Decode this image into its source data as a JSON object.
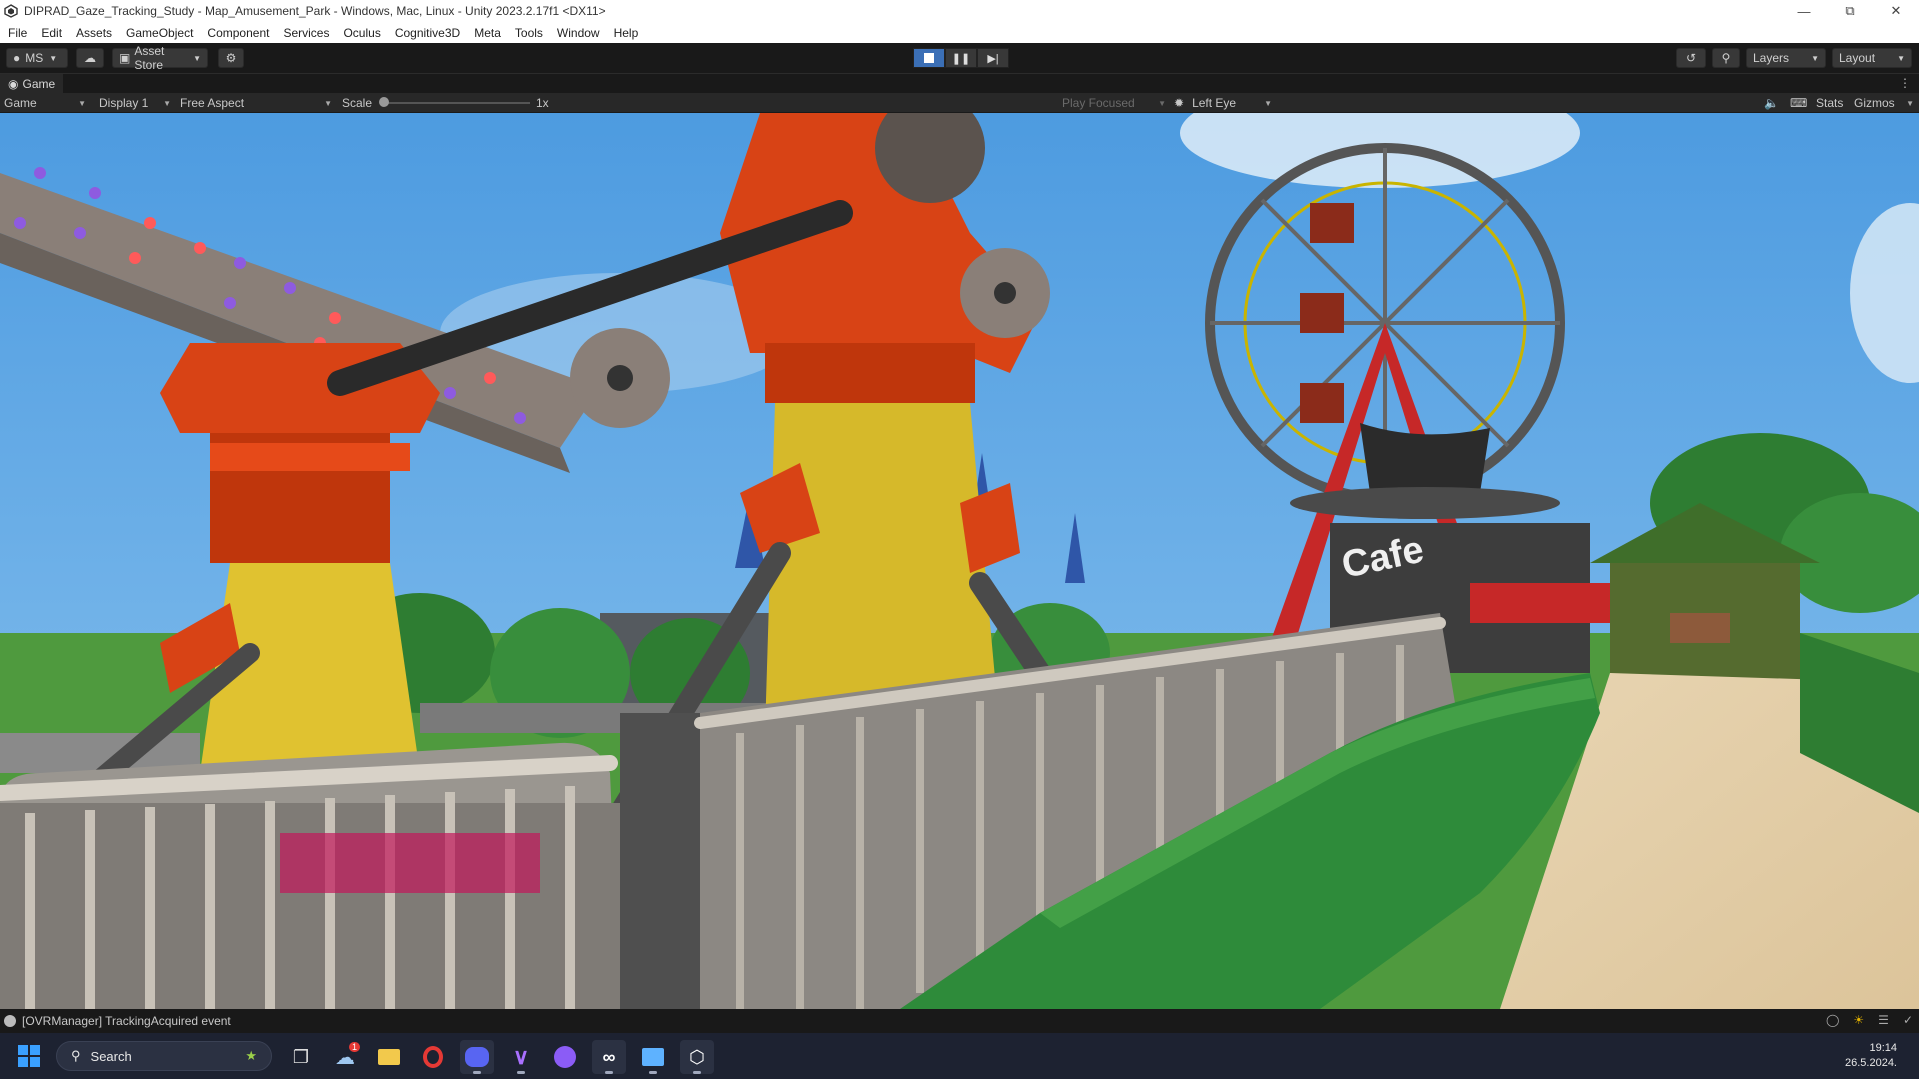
{
  "window": {
    "title": "DIPRAD_Gaze_Tracking_Study - Map_Amusement_Park - Windows, Mac, Linux - Unity 2023.2.17f1 <DX11>"
  },
  "menu": [
    "File",
    "Edit",
    "Assets",
    "GameObject",
    "Component",
    "Services",
    "Oculus",
    "Cognitive3D",
    "Meta",
    "Tools",
    "Window",
    "Help"
  ],
  "toolbar": {
    "account": "MS",
    "asset_store": "Asset Store",
    "layers": "Layers",
    "layout": "Layout"
  },
  "game_tab": {
    "label": "Game"
  },
  "game_bar": {
    "view_mode": "Game",
    "display": "Display 1",
    "aspect": "Free Aspect",
    "scale_label": "Scale",
    "scale_value": "1x",
    "play_focused": "Play Focused",
    "eye": "Left Eye",
    "stats": "Stats",
    "gizmos": "Gizmos"
  },
  "scene": {
    "cafe_sign": "Cafe"
  },
  "status": {
    "message": "[OVRManager] TrackingAcquired event"
  },
  "taskbar": {
    "search_label": "Search",
    "weather_badge": "1",
    "time": "19:14",
    "date": "26.5.2024."
  },
  "colors": {
    "unity_dark": "#191919",
    "panel": "#282828",
    "play_active": "#3b6fb6",
    "sky": "#5aa8e6",
    "taskbar": "#1d2231"
  }
}
